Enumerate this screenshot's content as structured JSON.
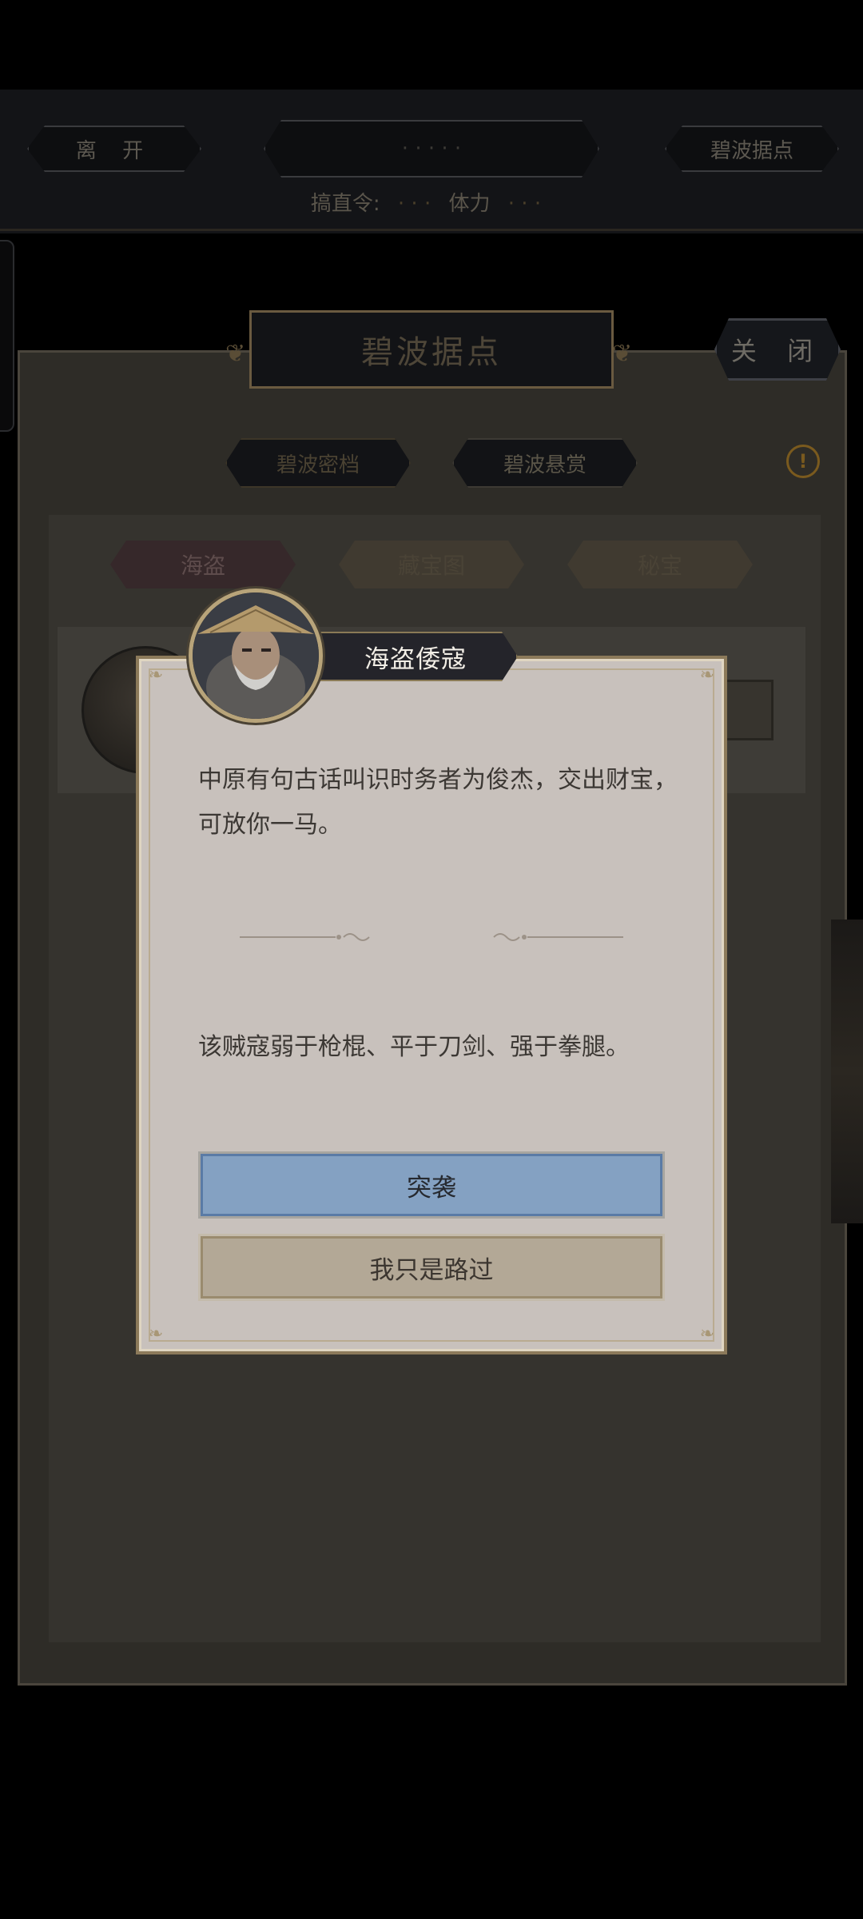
{
  "topbar": {
    "leave_label": "离 开",
    "center_label": "· · · · ·",
    "base_label": "碧波据点",
    "status_label_1": "搞直令:",
    "status_value_1": "· · ·",
    "status_label_2": "体力",
    "status_value_2": "· · ·"
  },
  "panel": {
    "title": "碧波据点",
    "close_label": "关 闭",
    "sub_tabs": [
      "碧波密档",
      "碧波悬赏"
    ],
    "category_tabs": [
      "海盗",
      "藏宝图",
      "秘宝"
    ]
  },
  "dialog": {
    "name": "海盗倭寇",
    "line1": "中原有句古话叫识时务者为俊杰，交出财宝，可放你一马。",
    "line2": "该贼寇弱于枪棍、平于刀剑、强于拳腿。",
    "raid_label": "突袭",
    "pass_label": "我只是路过"
  },
  "colors": {
    "raid_button": "#84a1c2",
    "pass_button": "#b3a896",
    "dialog_bg": "#c8c1bc",
    "banner_bg": "#24242a"
  }
}
